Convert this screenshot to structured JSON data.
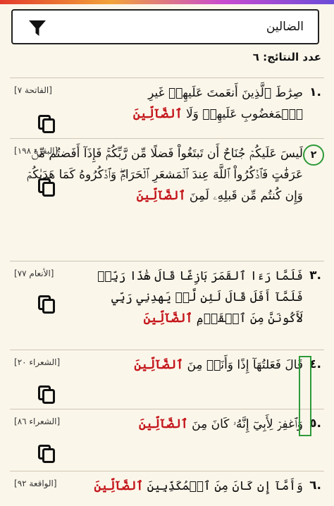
{
  "search": {
    "value": "الضالين"
  },
  "result_count": "عدد النتائج: ٦",
  "icons": {
    "filter": "filter-icon",
    "copy": "copy-icon"
  },
  "colors": {
    "highlight": "#c4171c",
    "marker": "#2e9a3a"
  },
  "results": [
    {
      "num": "١.",
      "ref": "[الفاتحة ٧]",
      "text": "صِرَٰطَ ٱلَّذِينَ أَنعَمتَ عَلَيهِمۡ غَيرِ ٱلۡمَغضُوبِ عَلَيهِمۡ وَلَا",
      "highlight": "ٱلضَّآلِّينَ"
    },
    {
      "num": "٢",
      "ref": "[البقرة ١٩٨]",
      "text": "لَيسَ عَلَيكُمۡ جُنَاحٌ أَن تَبتَغُواْ فَضلًا مِّن رَّبِّكُمۡۚ فَإِذَآ أَفَضتُم مِّنۡ عَرَفَٰتٍ فَٱذۡكُرُواْ ٱللَّهَ عِندَ ٱلۡمَشعَرِ ٱلۡحَرَامِۖ وَٱذۡكُرُوهُ كَمَا هَدَىٰكُمۡ وَإِن كُنتُم مِّن قَبلِهِۦ لَمِنَ",
      "highlight": "ٱلضَّآلِّينَ"
    },
    {
      "num": "٣.",
      "ref": "[الأنعام ٧٧]",
      "text": "فَلَمَّا رَءَا ٱلقَمَرَ بَازِغًا قَالَ هَٰذَا رَبِّيۖ فَلَمَّآ أَفَلَ قَالَ لَئِن لَّمۡ يَهدِنِي رَبِّي لَأَكُونَنَّ مِنَ ٱلۡقَوۡمِ",
      "highlight": "ٱلضَّآلِّينَ"
    },
    {
      "num": "٤.",
      "ref": "[الشعراء ٢٠]",
      "text": "قَالَ فَعَلتُهَآ إِذًا وَأَنَا۠ مِنَ",
      "highlight": "ٱلضَّآلِّينَ"
    },
    {
      "num": "٥.",
      "ref": "[الشعراء ٨٦]",
      "text": "وَٱغفِرۡ لِأَبِيٓ إِنَّهُۥ كَانَ مِنَ",
      "highlight": "ٱلضَّآلِّينَ"
    },
    {
      "num": "٦.",
      "ref": "[الواقعة ٩٢]",
      "text": "وَأَمَّآ إِن كَانَ مِنَ ٱلۡمُكَذِّبِينَ",
      "highlight": "ٱلضَّآلِّينَ"
    }
  ]
}
